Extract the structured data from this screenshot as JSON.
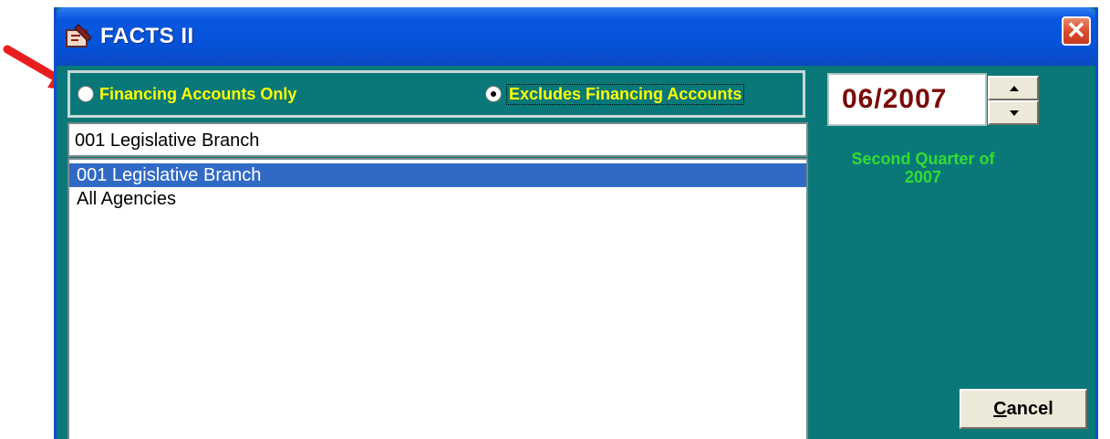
{
  "window": {
    "title": "FACTS II",
    "close_label": "✕"
  },
  "radio_group": {
    "option1_label": "Financing Accounts Only",
    "option1_selected": false,
    "option2_label": "Excludes Financing Accounts",
    "option2_selected": true
  },
  "agency_combo": {
    "value": "001 Legislative Branch"
  },
  "agency_list": {
    "items": [
      {
        "label": "001 Legislative Branch",
        "selected": true
      },
      {
        "label": "All Agencies",
        "selected": false
      }
    ]
  },
  "period": {
    "value": "06/2007",
    "description": "Second Quarter of 2007"
  },
  "buttons": {
    "cancel_first": "C",
    "cancel_rest": "ancel"
  },
  "colors": {
    "window_bg": "#0a7878",
    "radio_label": "#ffff00",
    "date_text": "#7a0a0a",
    "quarter_text": "#33dd33",
    "selection": "#316ac5",
    "annotation_arrow": "#e81e1e"
  },
  "icons": {
    "title_icon": "facts-app-icon",
    "annotation": "red-arrow-icon"
  }
}
